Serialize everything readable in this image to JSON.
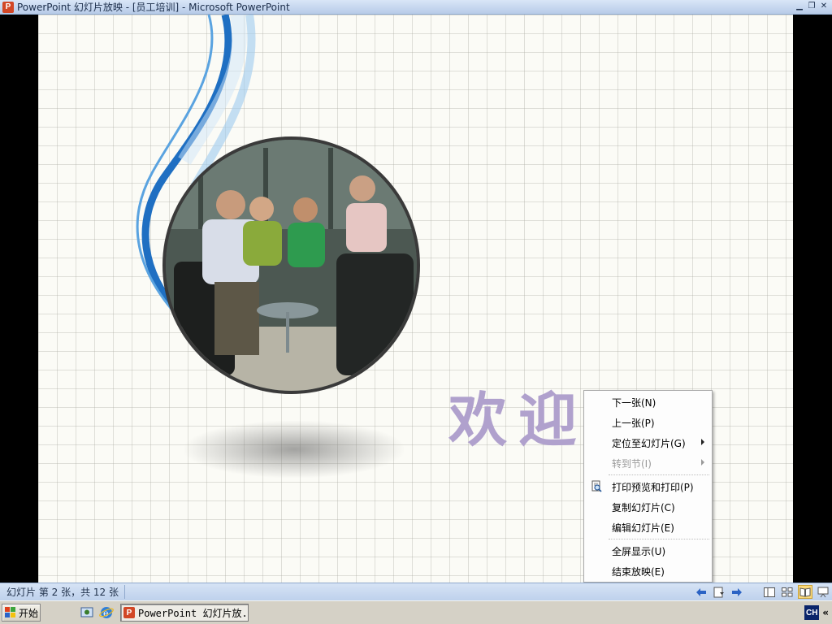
{
  "window": {
    "app_icon_letter": "P",
    "title": "PowerPoint 幻灯片放映 - [员工培训] - Microsoft PowerPoint",
    "minimize": "▁",
    "restore": "❐",
    "close": "✕"
  },
  "slide": {
    "welcome_text": "欢迎"
  },
  "context_menu": {
    "items": [
      {
        "label": "下一张(N)",
        "enabled": true,
        "submenu": false
      },
      {
        "label": "上一张(P)",
        "enabled": true,
        "submenu": false
      },
      {
        "label": "定位至幻灯片(G)",
        "enabled": true,
        "submenu": true
      },
      {
        "label": "转到节(I)",
        "enabled": false,
        "submenu": true
      },
      {
        "label": "打印预览和打印(P)",
        "enabled": true,
        "submenu": false,
        "icon": "print-preview-icon"
      },
      {
        "label": "复制幻灯片(C)",
        "enabled": true,
        "submenu": false
      },
      {
        "label": "编辑幻灯片(E)",
        "enabled": true,
        "submenu": false
      },
      {
        "label": "全屏显示(U)",
        "enabled": true,
        "submenu": false
      },
      {
        "label": "结束放映(E)",
        "enabled": true,
        "submenu": false
      }
    ]
  },
  "statusbar": {
    "slide_info": "幻灯片 第 2 张，共 12 张"
  },
  "taskbar": {
    "start_label": "开始",
    "task_label": "PowerPoint 幻灯片放...",
    "task_icon_letter": "P",
    "ime_label": "CH",
    "tray_chevron": "«"
  },
  "colors": {
    "welcome": "#b0a1cd",
    "swoosh_blue": "#1f6fc2",
    "titlebar": "#c6d7ef"
  }
}
